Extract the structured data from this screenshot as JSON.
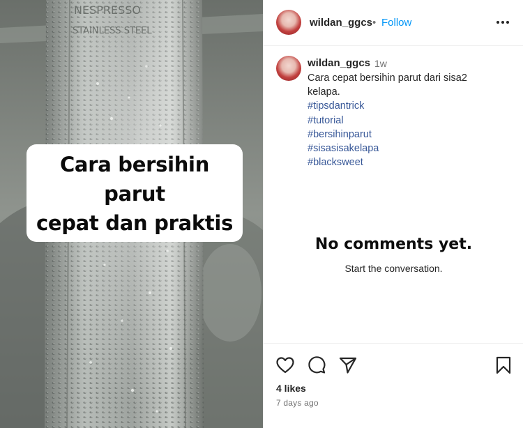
{
  "media": {
    "overlay_text": {
      "line1": "Cara bersihin parut",
      "line2": "cepat dan praktis"
    },
    "engraving": {
      "line1": "NESPRESSO",
      "line2": "STAINLESS STEEL"
    }
  },
  "header": {
    "username": "wildan_ggcs",
    "separator": "•",
    "follow_label": "Follow",
    "more_icon": "more-options-icon"
  },
  "caption": {
    "username": "wildan_ggcs",
    "time_ago_short": "1w",
    "text_line1": "Cara cepat bersihin parut dari sisa2",
    "text_line2": "kelapa.",
    "hashtags": [
      "#tipsdantrick",
      "#tutorial",
      "#bersihinparut",
      "#sisasisakelapa",
      "#blacksweet"
    ]
  },
  "comments": {
    "empty_title": "No comments yet.",
    "empty_subtitle": "Start the conversation."
  },
  "actions": {
    "icons": [
      "heart-icon",
      "comment-icon",
      "share-icon",
      "bookmark-icon"
    ],
    "likes": "4 likes",
    "time_ago": "7 days ago"
  },
  "colors": {
    "follow": "#0095f6",
    "hashtag": "#385898",
    "muted": "#737373",
    "text": "#262626"
  }
}
